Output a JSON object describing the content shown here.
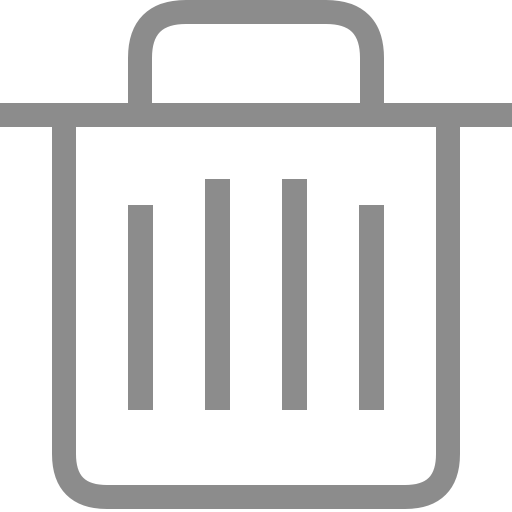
{
  "icon": {
    "name": "trash-icon",
    "color": "#8c8c8c",
    "background": "#ffffff"
  }
}
